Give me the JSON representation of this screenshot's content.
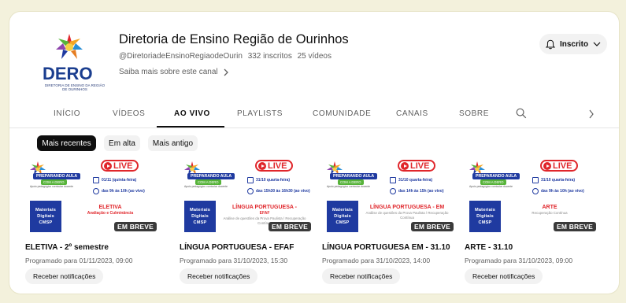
{
  "channel": {
    "name": "Diretoria de Ensino Região de Ourinhos",
    "handle": "@DiretoriadeEnsinoRegiaodeOurin",
    "subscribers": "332 inscritos",
    "videos": "25 vídeos",
    "about_link": "Saiba mais sobre este canal",
    "logo_text": "DERO",
    "logo_tagline": "DIRETORIA DE ENSINO DA REGIÃO DE OURINHOS"
  },
  "subscribe_button": {
    "label": "Inscrito"
  },
  "tabs": [
    {
      "label": "INÍCIO"
    },
    {
      "label": "VÍDEOS"
    },
    {
      "label": "AO VIVO"
    },
    {
      "label": "PLAYLISTS"
    },
    {
      "label": "COMUNIDADE"
    },
    {
      "label": "CANAIS"
    },
    {
      "label": "SOBRE"
    }
  ],
  "active_tab": "AO VIVO",
  "chips": [
    {
      "label": "Mais recentes",
      "selected": true
    },
    {
      "label": "Em alta",
      "selected": false
    },
    {
      "label": "Mais antigo",
      "selected": false
    }
  ],
  "videos": [
    {
      "thumb": {
        "banner": "PREPARANDO AULA",
        "banner2": "COM A DERO",
        "support": "Apoio pedagógico curricular docente",
        "live": "LIVE",
        "date_line": "01/11 (quinta-feira)",
        "time_line": "das 9h às 10h (ao vivo)",
        "materiais": [
          "Materiais",
          "Digitais",
          "CMSP"
        ],
        "subject": "ELETIVA",
        "subject2": "Avaliação e Culminância",
        "subject3": "",
        "badge": "EM BREVE"
      },
      "title": "ELETIVA - 2º semestre",
      "schedule": "Programado para 01/11/2023, 09:00",
      "notify": "Receber notificações"
    },
    {
      "thumb": {
        "banner": "PREPARANDO AULA",
        "banner2": "COM A DERO",
        "support": "Apoio pedagógico curricular docente",
        "live": "LIVE",
        "date_line": "31/10 quarta-feira)",
        "time_line": "das 15h30 às 16h30 (ao vivo)",
        "materiais": [
          "Materiais",
          "Digitais",
          "CMSP"
        ],
        "subject": "LÍNGUA PORTUGUESA -",
        "subject2": "EFAF",
        "subject3": "Análise de questões da Prova Paulista / Recuperação Contínua",
        "badge": "EM BREVE"
      },
      "title": "LÍNGUA PORTUGUESA - EFAF",
      "schedule": "Programado para 31/10/2023, 15:30",
      "notify": "Receber notificações"
    },
    {
      "thumb": {
        "banner": "PREPARANDO AULA",
        "banner2": "COM A DERO",
        "support": "Apoio pedagógico curricular docente",
        "live": "LIVE",
        "date_line": "31/10 quarta-feira)",
        "time_line": "das 14h às 15h (ao vivo)",
        "materiais": [
          "Materiais",
          "Digitais",
          "CMSP"
        ],
        "subject": "LÍNGUA PORTUGUESA - EM",
        "subject2": "",
        "subject3": "Análise de questões da Prova Paulista / Recuperação Contínua",
        "badge": "EM BREVE"
      },
      "title": "LÍNGUA PORTUGUESA EM - 31.10",
      "schedule": "Programado para 31/10/2023, 14:00",
      "notify": "Receber notificações"
    },
    {
      "thumb": {
        "banner": "PREPARANDO AULA",
        "banner2": "COM A DERO",
        "support": "Apoio pedagógico curricular docente",
        "live": "LIVE",
        "date_line": "31/10 quarta-feira)",
        "time_line": "das 9h às 10h (ao vivo)",
        "materiais": [
          "Materiais",
          "Digitais",
          "CMSP"
        ],
        "subject": "ARTE",
        "subject2": "",
        "subject3": "Recuperação Contínua",
        "badge": "EM BREVE"
      },
      "title": "ARTE - 31.10",
      "schedule": "Programado para 31/10/2023, 09:00",
      "notify": "Receber notificações"
    }
  ],
  "colors": {
    "page_background": "#f3f1dc",
    "live_red": "#e0262b",
    "brand_blue": "#1f3aa0",
    "brand_green": "#57b33a"
  },
  "icons": [
    "bell-icon",
    "chevron-down-icon",
    "chevron-right-icon",
    "search-icon",
    "tab-scroll-right-icon"
  ]
}
